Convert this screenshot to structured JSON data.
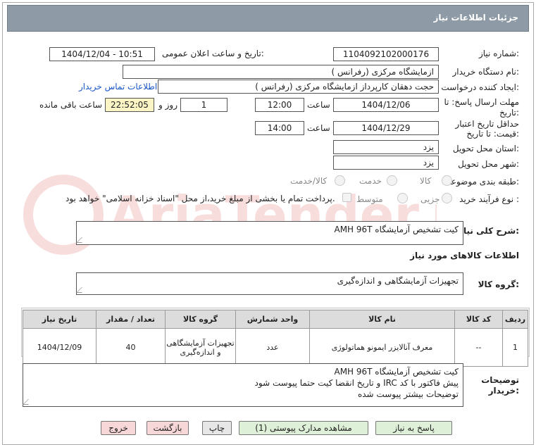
{
  "header": {
    "title": "جزئیات اطلاعات نیاز"
  },
  "fields": {
    "need_number_label": "شماره نیاز:",
    "need_number": "1104092102000176",
    "announce_label": "تاریخ و ساعت اعلان عمومی:",
    "announce_value": "1404/12/04 - 10:51",
    "buyer_org_label": "نام دستگاه خریدار:",
    "buyer_org": "ازمایشگاه مرکزی (رفرانس )",
    "creator_label": "ایجاد کننده درخواست:",
    "creator": "حجت دهقان کارپرداز ازمایشگاه مرکزی (رفرانس )",
    "contact_link": "اطلاعات تماس خریدار",
    "deadline_label_1": "مهلت ارسال پاسخ: تا",
    "deadline_label_2": "تاریخ:",
    "deadline_date": "1404/12/06",
    "time_label": "ساعت",
    "deadline_time": "12:00",
    "days_value": "1",
    "days_label": "روز و",
    "remaining_time": "22:52:05",
    "remaining_label": "ساعت باقی مانده",
    "validity_label_1": "حداقل تاریخ اعتبار",
    "validity_label_2": "قیمت: تا تاریخ:",
    "validity_date": "1404/12/29",
    "validity_time_label": "ساعت",
    "validity_time": "14:00",
    "province_label": "استان محل تحویل:",
    "province": "یزد",
    "city_label": "شهر محل تحویل:",
    "city": "یزد",
    "category_label": "طبقه بندی موضوعی:",
    "category_options": [
      "کالا",
      "خدمت",
      "کالا/خدمت"
    ],
    "process_label": "نوع فرآیند خرید :",
    "process_options": [
      "جزیی",
      "متوسط"
    ],
    "payment_note": "پرداخت تمام یا بخشی از مبلغ خرید،از محل \"اسناد خزانه اسلامی\" خواهد بود."
  },
  "summary": {
    "label": "شرح کلی نیاز:",
    "value": "کیت تشخیص آزمایشگاه  AMH 96T"
  },
  "goods_info_title": "اطلاعات کالاهای مورد نیاز",
  "goods_group": {
    "label": "گروه کالا:",
    "value": "تجهیزات آزمایشگاهی و اندازه‌گیری"
  },
  "table": {
    "headers": [
      "ردیف",
      "کد کالا",
      "نام کالا",
      "واحد شمارش",
      "گروه کالا",
      "تعداد / مقدار",
      "تاریخ نیاز"
    ],
    "rows": [
      {
        "row": "1",
        "code": "--",
        "name": "معرف آنالایزر ایمونو هماتولوژی",
        "unit": "عدد",
        "group": "تجهیزات آزمایشگاهی و اندازه‌گیری",
        "qty": "40",
        "date": "1404/12/09"
      }
    ]
  },
  "buyer_notes": {
    "label_1": "توضیحات",
    "label_2": "خریدار:",
    "line_1": "کیت تشخیص آزمایشگاه  AMH 96T",
    "line_2": "پیش فاکتور با کد IRC و تاریخ انقضا کیت حتما پیوست شود",
    "line_3": "توضیحات بیشتر پیوست شده"
  },
  "buttons": {
    "reply": "پاسخ به نیاز",
    "attachments": "مشاهده مدارک پیوستی (1)",
    "print": "چاپ",
    "back": "بازگشت",
    "exit": "خروج"
  },
  "watermark": {
    "text": "AriaTender.net"
  }
}
